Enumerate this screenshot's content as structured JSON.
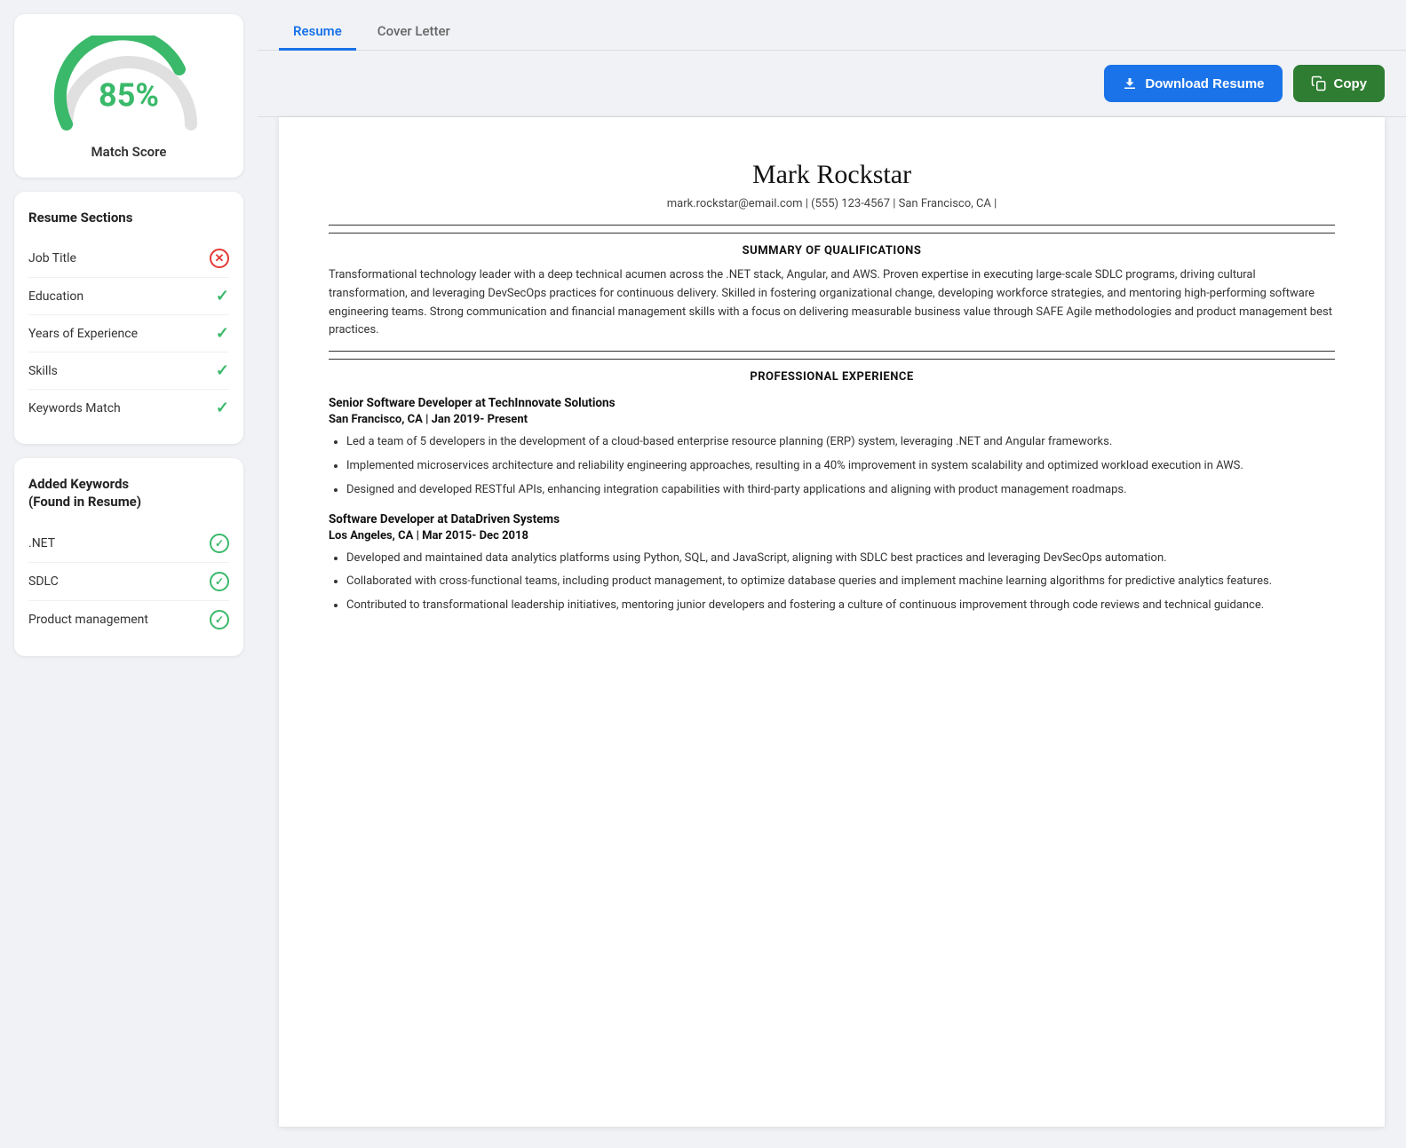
{
  "tabs": [
    {
      "id": "resume",
      "label": "Resume",
      "active": true
    },
    {
      "id": "cover-letter",
      "label": "Cover Letter",
      "active": false
    }
  ],
  "toolbar": {
    "download_label": "Download Resume",
    "copy_label": "Copy"
  },
  "left": {
    "match_score": {
      "value": "85%",
      "label": "Match Score",
      "percentage": 85
    },
    "resume_sections": {
      "title": "Resume Sections",
      "items": [
        {
          "label": "Job Title",
          "status": "fail"
        },
        {
          "label": "Education",
          "status": "pass"
        },
        {
          "label": "Years of Experience",
          "status": "pass"
        },
        {
          "label": "Skills",
          "status": "pass"
        },
        {
          "label": "Keywords Match",
          "status": "pass"
        }
      ]
    },
    "keywords": {
      "title": "Added Keywords\n(Found in Resume)",
      "items": [
        {
          "label": ".NET"
        },
        {
          "label": "SDLC"
        },
        {
          "label": "Product management"
        }
      ]
    }
  },
  "resume": {
    "name": "Mark Rockstar",
    "contact": "mark.rockstar@email.com  |  (555) 123-4567  |  San Francisco, CA  |",
    "summary_title": "SUMMARY OF QUALIFICATIONS",
    "summary_text": "Transformational technology leader with a deep technical acumen across the .NET stack, Angular, and AWS. Proven expertise in executing large-scale SDLC programs, driving cultural transformation, and leveraging DevSecOps practices for continuous delivery. Skilled in fostering organizational change, developing workforce strategies, and mentoring high-performing software engineering teams. Strong communication and financial management skills with a focus on delivering measurable business value through SAFE Agile methodologies and product management best practices.",
    "experience_title": "PROFESSIONAL EXPERIENCE",
    "jobs": [
      {
        "title": "Senior Software Developer at TechInnovate Solutions",
        "location": "San Francisco, CA | Jan 2019- Present",
        "bullets": [
          "Led a team of 5 developers in the development of a cloud-based enterprise resource planning (ERP) system, leveraging .NET and Angular frameworks.",
          "Implemented microservices architecture and reliability engineering approaches, resulting in a 40% improvement in system scalability and optimized workload execution in AWS.",
          "Designed and developed RESTful APIs, enhancing integration capabilities with third-party applications and aligning with product management roadmaps."
        ]
      },
      {
        "title": "Software Developer at DataDriven Systems",
        "location": "Los Angeles, CA | Mar 2015- Dec 2018",
        "bullets": [
          "Developed and maintained data analytics platforms using Python, SQL, and JavaScript, aligning with SDLC best practices and leveraging DevSecOps automation.",
          "Collaborated with cross-functional teams, including product management, to optimize database queries and implement machine learning algorithms for predictive analytics features.",
          "Contributed to transformational leadership initiatives, mentoring junior developers and fostering a culture of continuous improvement through code reviews and technical guidance."
        ]
      }
    ]
  }
}
